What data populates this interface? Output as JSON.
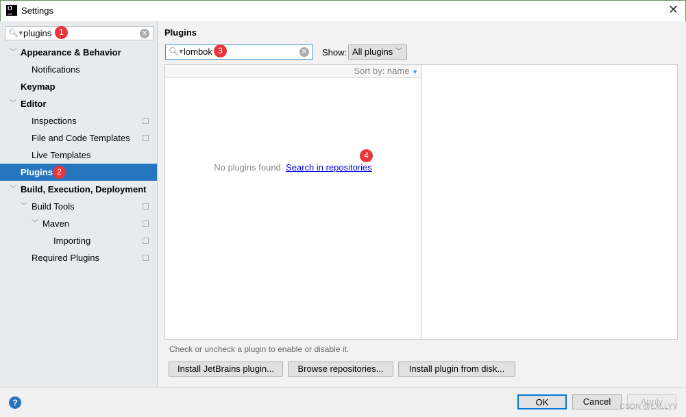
{
  "window": {
    "title": "Settings",
    "logo": "IJ"
  },
  "sidebar": {
    "search_value": "plugins",
    "items": [
      {
        "label": "Appearance & Behavior",
        "level": 0,
        "bold": true,
        "expanded": true
      },
      {
        "label": "Notifications",
        "level": 1
      },
      {
        "label": "Keymap",
        "level": 0,
        "bold": true
      },
      {
        "label": "Editor",
        "level": 0,
        "bold": true,
        "expanded": true
      },
      {
        "label": "Inspections",
        "level": 1,
        "copy": true
      },
      {
        "label": "File and Code Templates",
        "level": 1,
        "copy": true
      },
      {
        "label": "Live Templates",
        "level": 1
      },
      {
        "label": "Plugins",
        "level": 0,
        "bold": true,
        "selected": true
      },
      {
        "label": "Build, Execution, Deployment",
        "level": 0,
        "bold": true,
        "expanded": true
      },
      {
        "label": "Build Tools",
        "level": 1,
        "expanded": true,
        "copy": true
      },
      {
        "label": "Maven",
        "level": 2,
        "expanded": true,
        "copy": true
      },
      {
        "label": "Importing",
        "level": 3,
        "copy": true
      },
      {
        "label": "Required Plugins",
        "level": 1,
        "copy": true
      }
    ]
  },
  "main": {
    "title": "Plugins",
    "search_value": "lombok",
    "show_label": "Show:",
    "show_value": "All plugins",
    "sort_label": "Sort by: name",
    "empty_text": "No plugins found.",
    "search_link": "Search in repositories",
    "hint": "Check or uncheck a plugin to enable or disable it.",
    "buttons": [
      "Install JetBrains plugin...",
      "Browse repositories...",
      "Install plugin from disk..."
    ]
  },
  "footer": {
    "ok": "OK",
    "cancel": "Cancel",
    "apply": "Apply",
    "watermark": "CSDN @LXLLYY"
  },
  "badges": [
    "1",
    "2",
    "3",
    "4"
  ],
  "colors": {
    "selection": "#2675bf",
    "badge": "#e8363a",
    "link": "#0000ee"
  }
}
